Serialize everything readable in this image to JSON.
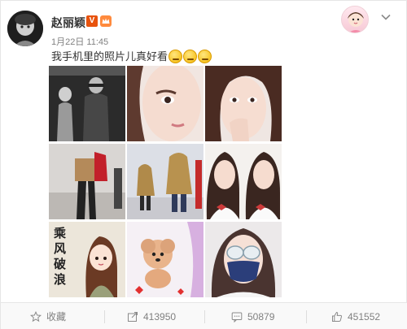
{
  "post": {
    "username": "赵丽颖",
    "vip_badge": "V",
    "time": "1月22日 11:45",
    "text": "我手机里的照片儿真好看",
    "emoji_count": 3
  },
  "photos": [
    {
      "name": "photo-1"
    },
    {
      "name": "photo-2"
    },
    {
      "name": "photo-3"
    },
    {
      "name": "photo-4"
    },
    {
      "name": "photo-5"
    },
    {
      "name": "photo-6"
    },
    {
      "name": "photo-7",
      "caption": "乘风破浪"
    },
    {
      "name": "photo-8"
    },
    {
      "name": "photo-9"
    }
  ],
  "actions": {
    "favorite_label": "收藏",
    "share_count": "413950",
    "comment_count": "50879",
    "like_count": "451552"
  },
  "colors": {
    "accent": "#e8530e",
    "muted_text": "#808080",
    "footer_bg": "#f9f9f9"
  }
}
